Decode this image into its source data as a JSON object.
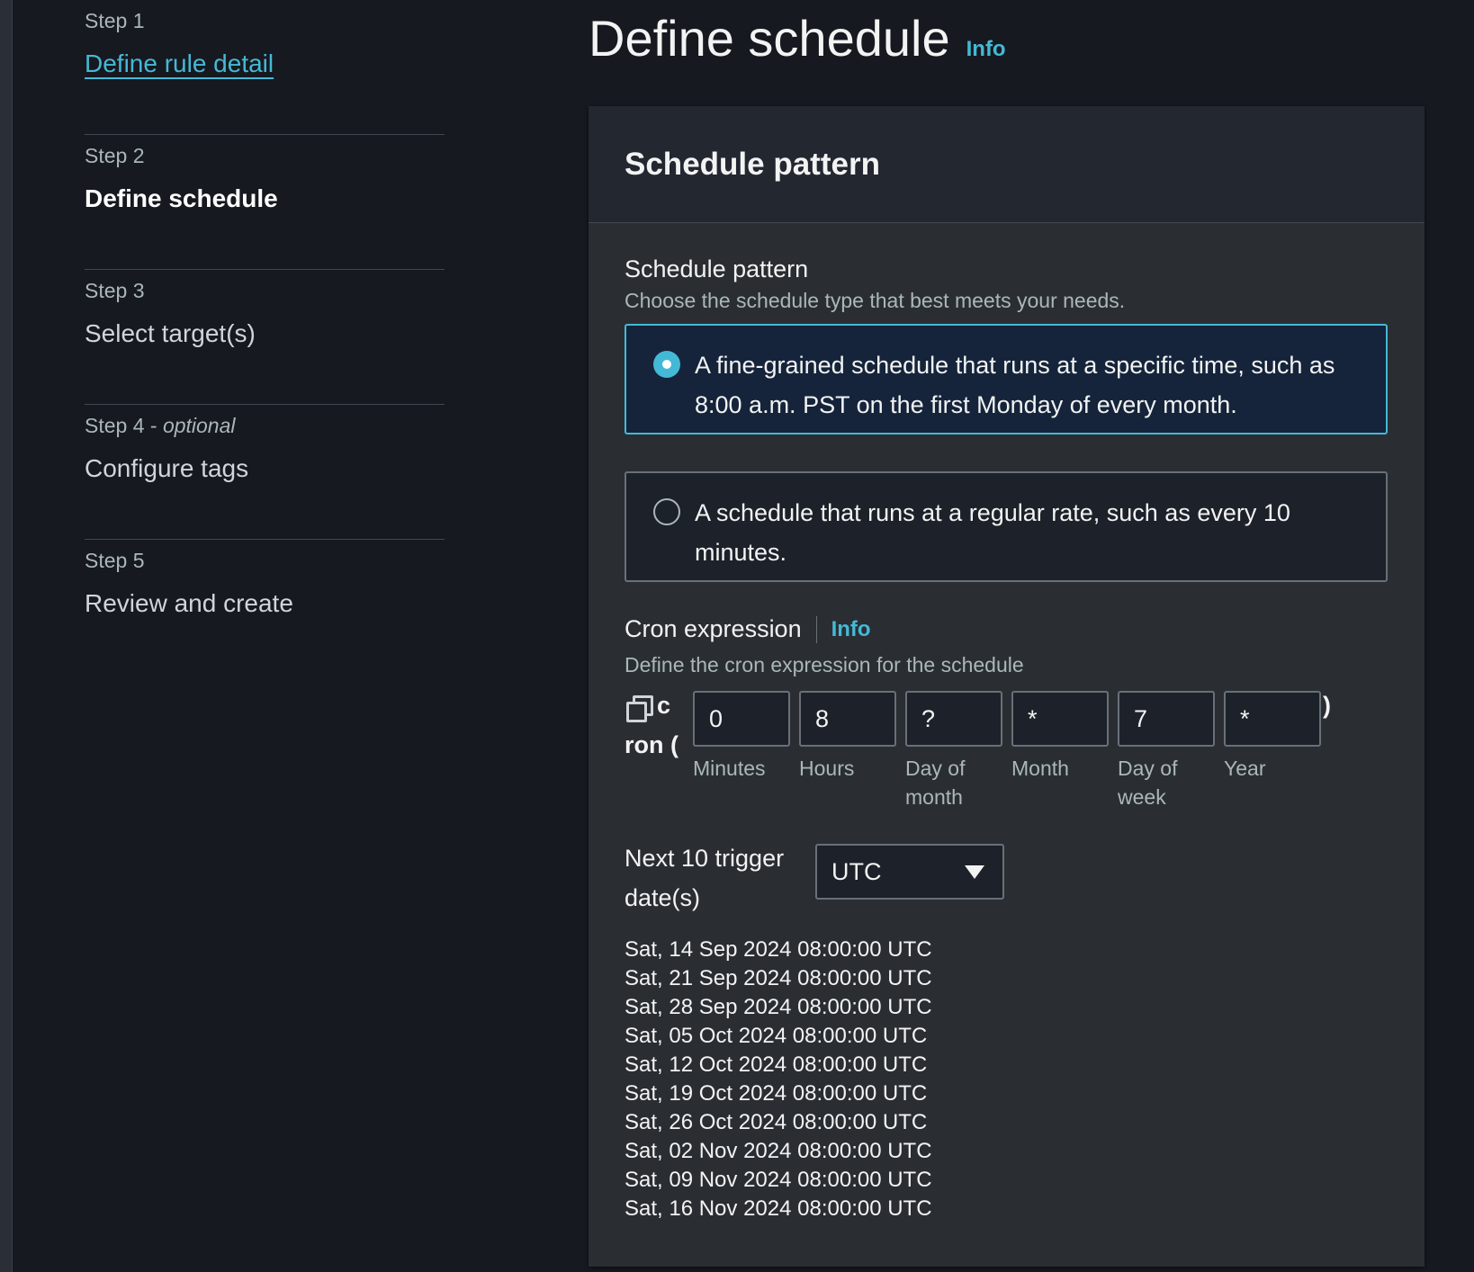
{
  "steps": [
    {
      "number": "Step 1",
      "optional": "",
      "title": "Define rule detail",
      "state": "link"
    },
    {
      "number": "Step 2",
      "optional": "",
      "title": "Define schedule",
      "state": "active"
    },
    {
      "number": "Step 3",
      "optional": "",
      "title": "Select target(s)",
      "state": "pending"
    },
    {
      "number": "Step 4 - ",
      "optional": "optional",
      "title": "Configure tags",
      "state": "pending"
    },
    {
      "number": "Step 5",
      "optional": "",
      "title": "Review and create",
      "state": "pending"
    }
  ],
  "page": {
    "title": "Define schedule",
    "info_label": "Info"
  },
  "panel": {
    "title": "Schedule pattern",
    "pattern_label": "Schedule pattern",
    "pattern_description": "Choose the schedule type that best meets your needs.",
    "options": [
      {
        "text": "A fine-grained schedule that runs at a specific time, such as 8:00 a.m. PST on the first Monday of every month.",
        "selected": true
      },
      {
        "text": "A schedule that runs at a regular rate, such as every 10 minutes.",
        "selected": false
      }
    ],
    "cron": {
      "label": "Cron expression",
      "info_label": "Info",
      "description": "Define the cron expression for the schedule",
      "prefix_first": "c",
      "prefix_rest": "ron (",
      "suffix": ")",
      "fields": [
        {
          "value": "0",
          "label": "Minutes"
        },
        {
          "value": "8",
          "label": "Hours"
        },
        {
          "value": "?",
          "label": "Day of month"
        },
        {
          "value": "*",
          "label": "Month"
        },
        {
          "value": "7",
          "label": "Day of week"
        },
        {
          "value": "*",
          "label": "Year"
        }
      ]
    },
    "trigger": {
      "label": "Next 10 trigger date(s)",
      "timezone": "UTC",
      "dates": [
        "Sat, 14 Sep 2024 08:00:00 UTC",
        "Sat, 21 Sep 2024 08:00:00 UTC",
        "Sat, 28 Sep 2024 08:00:00 UTC",
        "Sat, 05 Oct 2024 08:00:00 UTC",
        "Sat, 12 Oct 2024 08:00:00 UTC",
        "Sat, 19 Oct 2024 08:00:00 UTC",
        "Sat, 26 Oct 2024 08:00:00 UTC",
        "Sat, 02 Nov 2024 08:00:00 UTC",
        "Sat, 09 Nov 2024 08:00:00 UTC",
        "Sat, 16 Nov 2024 08:00:00 UTC"
      ]
    }
  }
}
